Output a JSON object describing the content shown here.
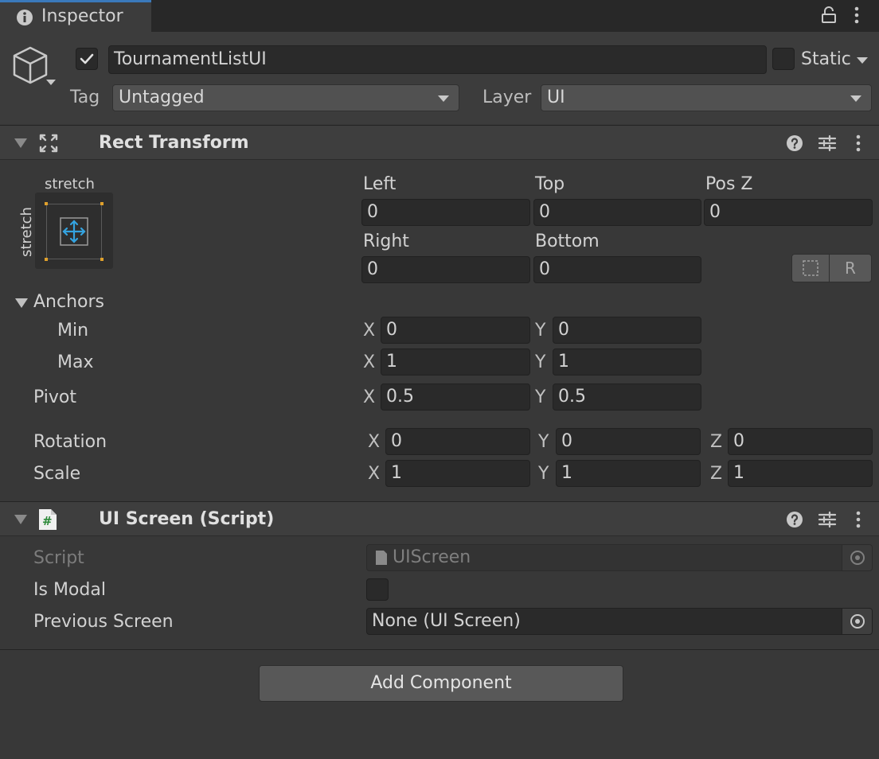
{
  "tab": {
    "title": "Inspector"
  },
  "object": {
    "name": "TournamentListUI",
    "active": true,
    "static_label": "Static",
    "tag_label": "Tag",
    "tag_value": "Untagged",
    "layer_label": "Layer",
    "layer_value": "UI"
  },
  "rect_transform": {
    "title": "Rect Transform",
    "anchor_preset": {
      "horizontal": "stretch",
      "vertical": "stretch"
    },
    "labels": {
      "left": "Left",
      "top": "Top",
      "posz": "Pos Z",
      "right": "Right",
      "bottom": "Bottom"
    },
    "values": {
      "left": "0",
      "top": "0",
      "posz": "0",
      "right": "0",
      "bottom": "0"
    },
    "raw_button": "R",
    "anchors_label": "Anchors",
    "min_label": "Min",
    "max_label": "Max",
    "pivot_label": "Pivot",
    "rotation_label": "Rotation",
    "scale_label": "Scale",
    "axis": {
      "x": "X",
      "y": "Y",
      "z": "Z"
    },
    "anchor_min": {
      "x": "0",
      "y": "0"
    },
    "anchor_max": {
      "x": "1",
      "y": "1"
    },
    "pivot": {
      "x": "0.5",
      "y": "0.5"
    },
    "rotation": {
      "x": "0",
      "y": "0",
      "z": "0"
    },
    "scale": {
      "x": "1",
      "y": "1",
      "z": "1"
    }
  },
  "ui_screen": {
    "title": "UI Screen (Script)",
    "script_label": "Script",
    "script_value": "UIScreen",
    "is_modal_label": "Is Modal",
    "is_modal": false,
    "previous_screen_label": "Previous Screen",
    "previous_screen_value": "None (UI Screen)"
  },
  "add_component": "Add Component",
  "colors": {
    "accent": "#3a79bb",
    "background": "#383838",
    "field": "#2a2a2a",
    "anchor_dot": "#e0a12c",
    "anchor_arrows": "#34a3e0"
  },
  "icons": [
    "info-icon",
    "lock-icon",
    "more-icon",
    "gameobject-cube-icon",
    "checkmark-icon",
    "rect-transform-icon",
    "help-icon",
    "presets-icon",
    "script-file-icon",
    "object-picker-icon",
    "blueprint-icon"
  ]
}
